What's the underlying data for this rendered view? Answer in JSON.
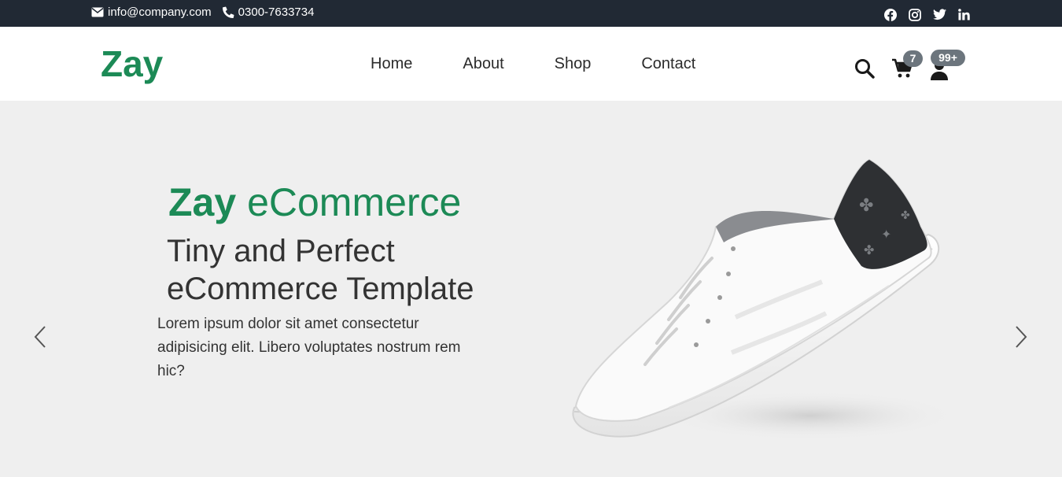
{
  "topbar": {
    "email": "info@company.com",
    "phone": "0300-7633734",
    "socials": [
      "facebook-icon",
      "instagram-icon",
      "twitter-icon",
      "linkedin-icon"
    ]
  },
  "header": {
    "brand": "Zay",
    "nav": [
      "Home",
      "About",
      "Shop",
      "Contact"
    ],
    "cart_count": "7",
    "user_count": "99+"
  },
  "hero": {
    "title_strong": "Zay",
    "title_rest": " eCommerce",
    "subtitle": "Tiny and Perfect eCommerce Template",
    "description": "Lorem ipsum dolor sit amet consectetur adipisicing elit. Libero voluptates nostrum rem hic?"
  },
  "colors": {
    "brand_green": "#1c8a56",
    "topbar_bg": "#212934",
    "hero_bg": "#efefef",
    "badge_bg": "#6c757d"
  }
}
